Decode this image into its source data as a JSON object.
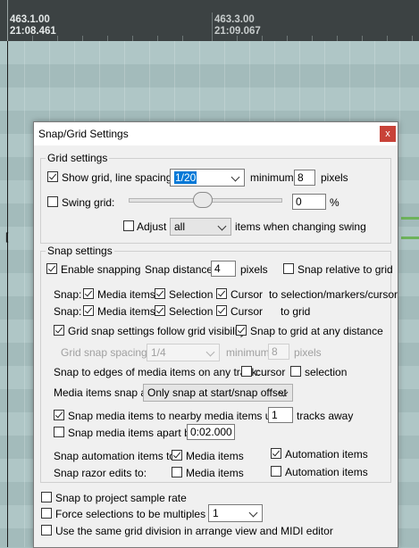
{
  "ruler": {
    "marker1_bar": "463.1.00",
    "marker1_time": "21:08.461",
    "marker2_bar": "463.3.00",
    "marker2_time": "21:09.067"
  },
  "dialog": {
    "title": "Snap/Grid Settings",
    "close_label": "x",
    "grid": {
      "group_title": "Grid settings",
      "show_grid_label": "Show grid, line spacing:",
      "show_grid_checked": true,
      "line_spacing_value": "1/20",
      "minimum_label": "minimum:",
      "minimum_value": "8",
      "pixels_label": "pixels",
      "swing_label": "Swing grid:",
      "swing_checked": false,
      "swing_value": "0",
      "swing_unit": "%",
      "swing_slider_level": 0.5,
      "adjust_label": "Adjust",
      "adjust_checked": false,
      "adjust_value": "all",
      "adjust_suffix": "items when changing swing"
    },
    "snap": {
      "group_title": "Snap settings",
      "enable_label": "Enable snapping",
      "enable_checked": true,
      "distance_label": "Snap distance:",
      "distance_value": "4",
      "distance_unit": "pixels",
      "relative_label": "Snap relative to grid",
      "relative_checked": false,
      "row1": {
        "prefix": "Snap:",
        "media_label": "Media items",
        "selection_label": "Selection",
        "cursor_label": "Cursor",
        "suffix": "to selection/markers/cursor"
      },
      "row2": {
        "prefix": "Snap:",
        "media_label": "Media items",
        "selection_label": "Selection",
        "cursor_label": "Cursor",
        "suffix": "to grid"
      },
      "follow_visibility_label": "Grid snap settings follow grid visibility",
      "follow_visibility_checked": true,
      "any_distance_label": "Snap to grid at any distance",
      "any_distance_checked": true,
      "grid_spacing_label": "Grid snap spacing:",
      "grid_spacing_value": "1/4",
      "grid_min_label": "minimum:",
      "grid_min_value": "8",
      "grid_min_unit": "pixels",
      "edges_label": "Snap to edges of media items on any track:",
      "edges_cursor_label": "cursor",
      "edges_cursor_checked": false,
      "edges_selection_label": "selection",
      "edges_selection_checked": false,
      "items_snap_label": "Media items snap at:",
      "items_snap_value": "Only snap at start/snap offset",
      "nearby_label": "Snap media items to nearby media items up to:",
      "nearby_checked": true,
      "nearby_value": "1",
      "nearby_unit": "tracks away",
      "apart_label": "Snap media items apart by:",
      "apart_checked": false,
      "apart_value": "0:02.000",
      "automation_label": "Snap automation items to:",
      "automation_media_label": "Media items",
      "automation_media_checked": true,
      "automation_auto_label": "Automation items",
      "automation_auto_checked": true,
      "razor_label": "Snap razor edits to:",
      "razor_media_label": "Media items",
      "razor_media_checked": false,
      "razor_auto_label": "Automation items",
      "razor_auto_checked": false
    },
    "bottom": {
      "sample_rate_label": "Snap to project sample rate",
      "sample_rate_checked": false,
      "multiples_label": "Force selections to be multiples of:",
      "multiples_checked": false,
      "multiples_value": "1",
      "same_grid_label": "Use the same grid division in arrange view and MIDI editor",
      "same_grid_checked": false
    }
  }
}
